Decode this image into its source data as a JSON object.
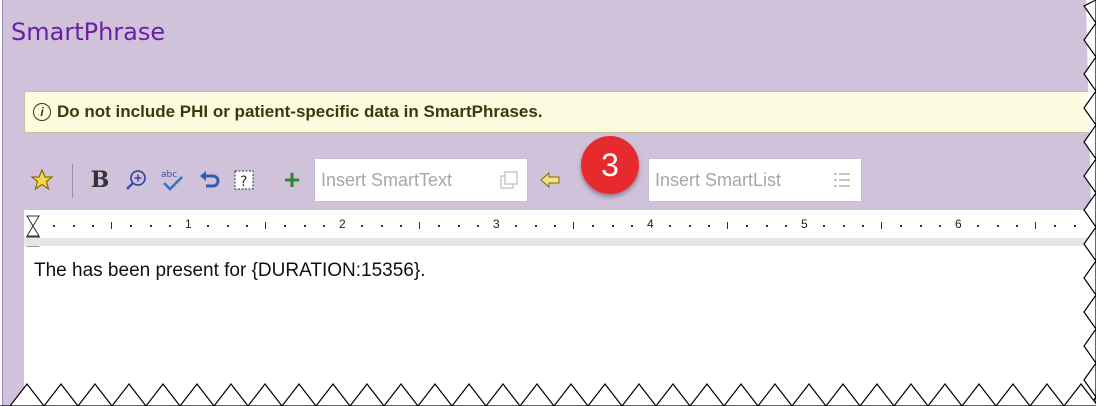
{
  "panel": {
    "title": "SmartPhrase",
    "warning": {
      "icon": "info-icon",
      "text": "Do not include PHI or patient-specific data in SmartPhrases."
    }
  },
  "toolbar": {
    "icons": [
      "favorite-star-icon",
      "bold-icon",
      "zoom-in-icon",
      "spellcheck-icon",
      "undo-icon",
      "smart-help-icon",
      "add-icon",
      "insert-arrow-left-icon",
      "insert-list-icon"
    ],
    "smarttext_placeholder": "Insert SmartText",
    "smartlist_placeholder": "Insert SmartList"
  },
  "callout": {
    "number": "3",
    "color": "#e62a2e"
  },
  "ruler": {
    "marks": [
      "1",
      "2",
      "3",
      "4",
      "5",
      "6"
    ]
  },
  "editor": {
    "text": "The has been present for {DURATION:15356}."
  },
  "colors": {
    "panel": "#d1c2dc",
    "title": "#6b1fa3",
    "warning_bg": "#fcfce0",
    "add_green": "#2a8a2e"
  }
}
